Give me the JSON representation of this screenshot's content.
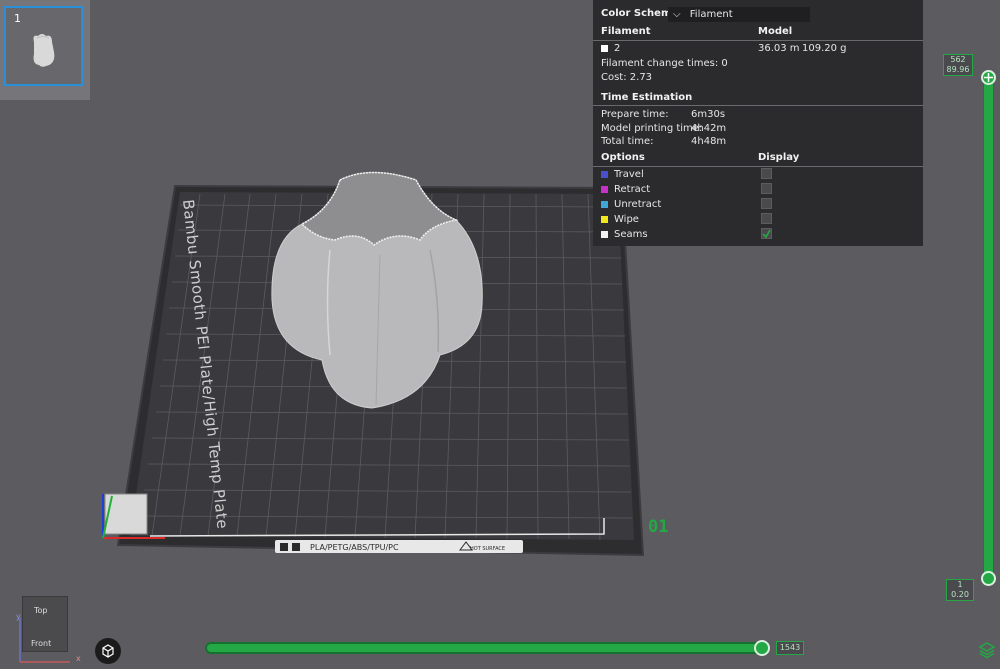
{
  "plate_list": {
    "plate_number": "1"
  },
  "plate": {
    "label": "Bambu Smooth PEI Plate/High Temp Plate",
    "bottom_label": "PLA/PETG/ABS/TPU/PC",
    "hot_surface": "HOT SURFACE",
    "plate_index": "01"
  },
  "legend": {
    "color_scheme_label": "Color Scheme",
    "color_scheme_value": "Filament",
    "filament_header": "Filament",
    "model_header": "Model",
    "filament_row": {
      "name": "2",
      "length": "36.03 m",
      "weight": "109.20 g",
      "color": "#ffffff"
    },
    "filament_change_times": "Filament change times:  0",
    "cost": "Cost:  2.73",
    "time_estimation_header": "Time Estimation",
    "prepare_time_label": "Prepare time:",
    "prepare_time_value": "6m30s",
    "model_printing_time_label": "Model printing time:",
    "model_printing_time_value": "4h42m",
    "total_time_label": "Total time:",
    "total_time_value": "4h48m",
    "options_header": "Options",
    "display_header": "Display",
    "options": [
      {
        "label": "Travel",
        "color": "#4a50c9",
        "checked": false
      },
      {
        "label": "Retract",
        "color": "#c632c8",
        "checked": false
      },
      {
        "label": "Unretract",
        "color": "#3fa7d6",
        "checked": false
      },
      {
        "label": "Wipe",
        "color": "#f0e81a",
        "checked": false
      },
      {
        "label": "Seams",
        "color": "#f2f2f2",
        "checked": true
      }
    ]
  },
  "layer_slider": {
    "top_layer": "562",
    "top_height": "89.96",
    "bottom_layer": "1",
    "bottom_height": "0.20"
  },
  "move_slider": {
    "value": "1543"
  },
  "nav_cube": {
    "top": "Top",
    "front": "Front",
    "axis_x": "x",
    "axis_y": "y"
  },
  "colors": {
    "accent": "#23a845",
    "panel": "#2b2b2d",
    "background": "#5b5b60"
  }
}
